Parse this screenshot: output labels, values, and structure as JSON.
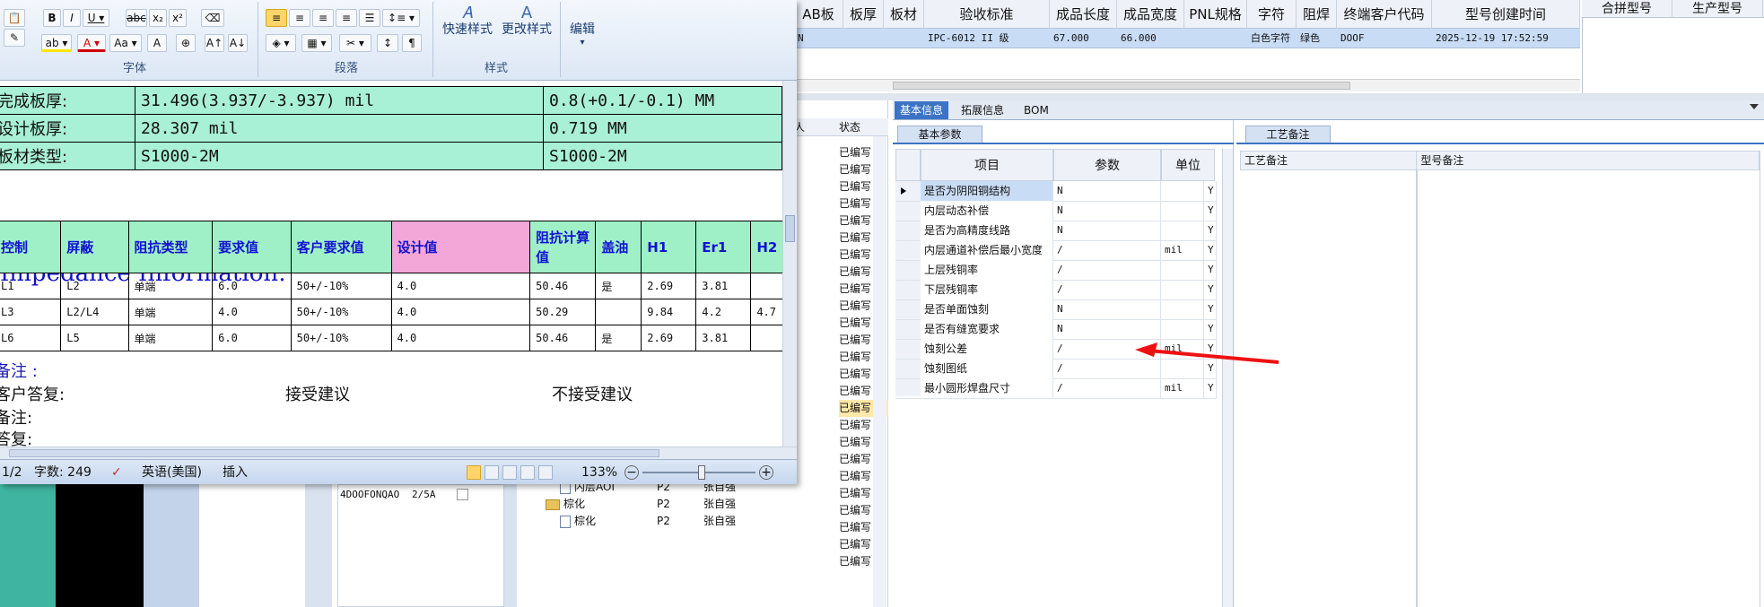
{
  "erp": {
    "top_columns": [
      "AB板",
      "板厚",
      "板材",
      "验收标准",
      "成品长度",
      "成品宽度",
      "PNL规格",
      "字符",
      "阻焊",
      "终端客户代码",
      "型号创建时间"
    ],
    "top_row": [
      "N",
      "",
      "",
      "IPC-6012 II 级",
      "67.000",
      "66.000",
      "",
      "白色字符",
      "绿色",
      "DOOF",
      "2025-12-19 17:52:59"
    ],
    "right_columns": [
      "合拼型号",
      "生产型号"
    ],
    "status_header": "状态",
    "status_header_prefix": "人",
    "status_items": [
      "已编写",
      "已编写",
      "已编写",
      "已编写",
      "已编写",
      "已编写",
      "已编写",
      "已编写",
      "已编写",
      "已编写",
      "已编写",
      "已编写",
      "已编写",
      "已编写",
      "已编写",
      "已编写",
      "已编写",
      "已编写",
      "已编写",
      "已编写",
      "已编写",
      "已编写",
      "已编写",
      "已编写",
      "已编写"
    ],
    "tabs": [
      "基本信息",
      "拓展信息",
      "BOM"
    ],
    "params_subtab": "基本参数",
    "params_columns": [
      "项目",
      "参数",
      "单位"
    ],
    "params_rows": [
      {
        "item": "是否为阴阳铜结构",
        "param": "N",
        "unit": "",
        "flag": "Y"
      },
      {
        "item": "内层动态补偿",
        "param": "N",
        "unit": "",
        "flag": "Y"
      },
      {
        "item": "是否为高精度线路",
        "param": "N",
        "unit": "",
        "flag": "Y"
      },
      {
        "item": "内层通道补偿后最小宽度",
        "param": "/",
        "unit": "mil",
        "flag": "Y"
      },
      {
        "item": "上层残铜率",
        "param": "/",
        "unit": "",
        "flag": "Y"
      },
      {
        "item": "下层残铜率",
        "param": "/",
        "unit": "",
        "flag": "Y"
      },
      {
        "item": "是否单面蚀刻",
        "param": "N",
        "unit": "",
        "flag": "Y"
      },
      {
        "item": "是否有缝宽要求",
        "param": "N",
        "unit": "",
        "flag": "Y"
      },
      {
        "item": "蚀刻公差",
        "param": "/",
        "unit": "mil",
        "flag": "Y"
      },
      {
        "item": "蚀刻图纸",
        "param": "/",
        "unit": "",
        "flag": "Y"
      },
      {
        "item": "最小圆形焊盘尺寸",
        "param": "/",
        "unit": "mil",
        "flag": "Y"
      }
    ],
    "notes_subtab": "工艺备注",
    "notes_columns": [
      "工艺备注",
      "型号备注"
    ],
    "left_table_row": [
      "4DOOFONQAO",
      "2/5A"
    ],
    "tree": [
      {
        "label": "内层AOI",
        "c1": "P2",
        "c2": "张自强",
        "type": "file"
      },
      {
        "label": "棕化",
        "c1": "P2",
        "c2": "张自强",
        "type": "folder"
      },
      {
        "label": "棕化",
        "c1": "P2",
        "c2": "张自强",
        "type": "file"
      }
    ]
  },
  "word": {
    "groups": [
      "字体",
      "段落",
      "快速样式",
      "更改样式",
      "样式",
      "编辑"
    ],
    "doc_fragments": {
      "finish_label": "完成板厚:",
      "finish_val": "31.496(3.937/-3.937) mil",
      "finish_mm": "0.8(+0.1/-0.1) MM",
      "design_label": "设计板厚:",
      "design_val": "28.307 mil",
      "design_mm": "0.719 MM",
      "mat_label": "板材类型:",
      "mat_val": "S1000-2M",
      "mat_val2": "S1000-2M"
    },
    "impedance_title": "Impedance Information:",
    "imp_columns": [
      "控制",
      "屏蔽",
      "阻抗类型",
      "要求值",
      "客户要求值",
      "设计值",
      "阻抗计算值",
      "盖油",
      "H1",
      "Er1",
      "H2"
    ],
    "imp_rows": [
      [
        "L1",
        "L2",
        "单端",
        "6.0",
        "50+/-10%",
        "4.0",
        "50.46",
        "是",
        "2.69",
        "3.81",
        ""
      ],
      [
        "L3",
        "L2/L4",
        "单端",
        "4.0",
        "50+/-10%",
        "4.0",
        "50.29",
        "",
        "9.84",
        "4.2",
        "4.7"
      ],
      [
        "L6",
        "L5",
        "单端",
        "6.0",
        "50+/-10%",
        "4.0",
        "50.46",
        "是",
        "2.69",
        "3.81",
        ""
      ]
    ],
    "notes": {
      "remark_blue": "备注 :",
      "reply": "客户答复:",
      "accept": "接受建议",
      "reject": "不接受建议",
      "remark2": "备注:",
      "reply2": "答复:"
    },
    "status": {
      "page": "1/2",
      "words": "字数: 249",
      "lang": "英语(美国)",
      "mode": "插入",
      "zoom": "133%"
    }
  }
}
